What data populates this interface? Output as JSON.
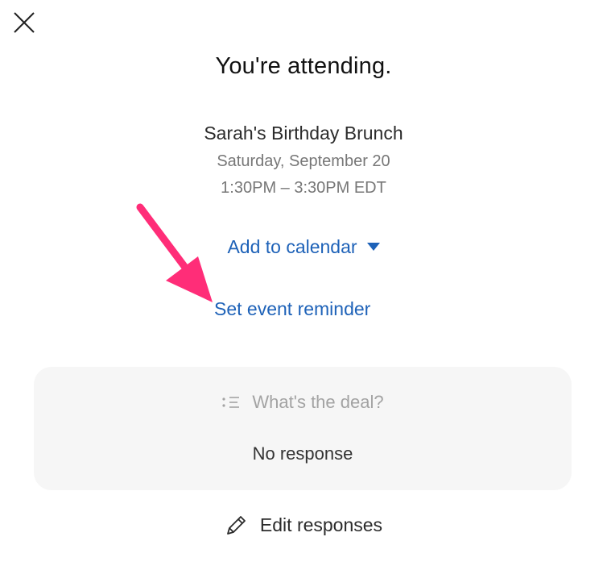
{
  "header": {
    "close_icon": "close-icon",
    "title": "You're attending."
  },
  "event": {
    "name": "Sarah's Birthday Brunch",
    "date": "Saturday, September 20",
    "time": "1:30PM – 3:30PM EDT"
  },
  "actions": {
    "add_to_calendar_label": "Add to calendar",
    "add_to_calendar_icon": "caret-down-icon",
    "set_reminder_label": "Set event reminder",
    "annotation_color": "#ff2d78"
  },
  "deal": {
    "icon": "list-icon",
    "question": "What's the deal?",
    "answer": "No response"
  },
  "footer": {
    "edit_icon": "pencil-icon",
    "edit_label": "Edit responses"
  },
  "colors": {
    "link": "#1e62b8",
    "card_bg": "#f6f6f6"
  }
}
